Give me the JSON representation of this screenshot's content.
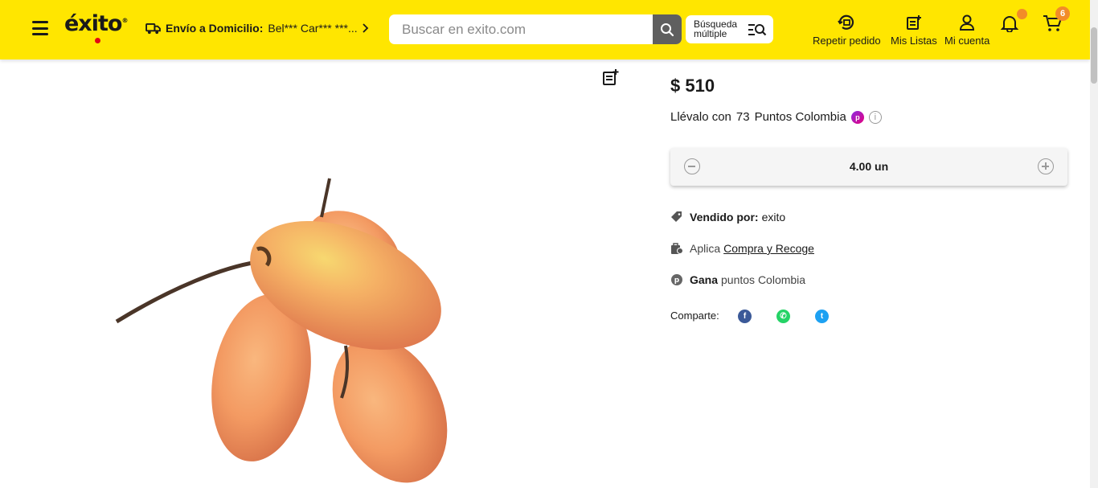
{
  "header": {
    "logo": "éxito",
    "delivery_label": "Envío a Domicilio:",
    "delivery_address": "Bel*** Car*** ***...",
    "search_placeholder": "Buscar en exito.com",
    "multi_search_line1": "Búsqueda",
    "multi_search_line2": "múltiple",
    "repeat_order": "Repetir pedido",
    "my_lists": "Mis Listas",
    "my_account": "Mi cuenta",
    "cart_count": "6"
  },
  "product": {
    "price": "$ 510",
    "points_prefix": "Llévalo con",
    "points_value": "73",
    "points_suffix": "Puntos Colombia",
    "quantity": "4.00 un",
    "sold_by_label": "Vendido por:",
    "sold_by_value": "exito",
    "pickup_prefix": "Aplica",
    "pickup_link": "Compra y Recoge",
    "earn_label": "Gana",
    "earn_value": "puntos Colombia",
    "share_label": "Comparte:"
  },
  "colors": {
    "brand_yellow": "#FFE600",
    "badge_orange": "#F28C28",
    "facebook": "#3b5998",
    "whatsapp": "#25D366",
    "twitter": "#1DA1F2"
  }
}
